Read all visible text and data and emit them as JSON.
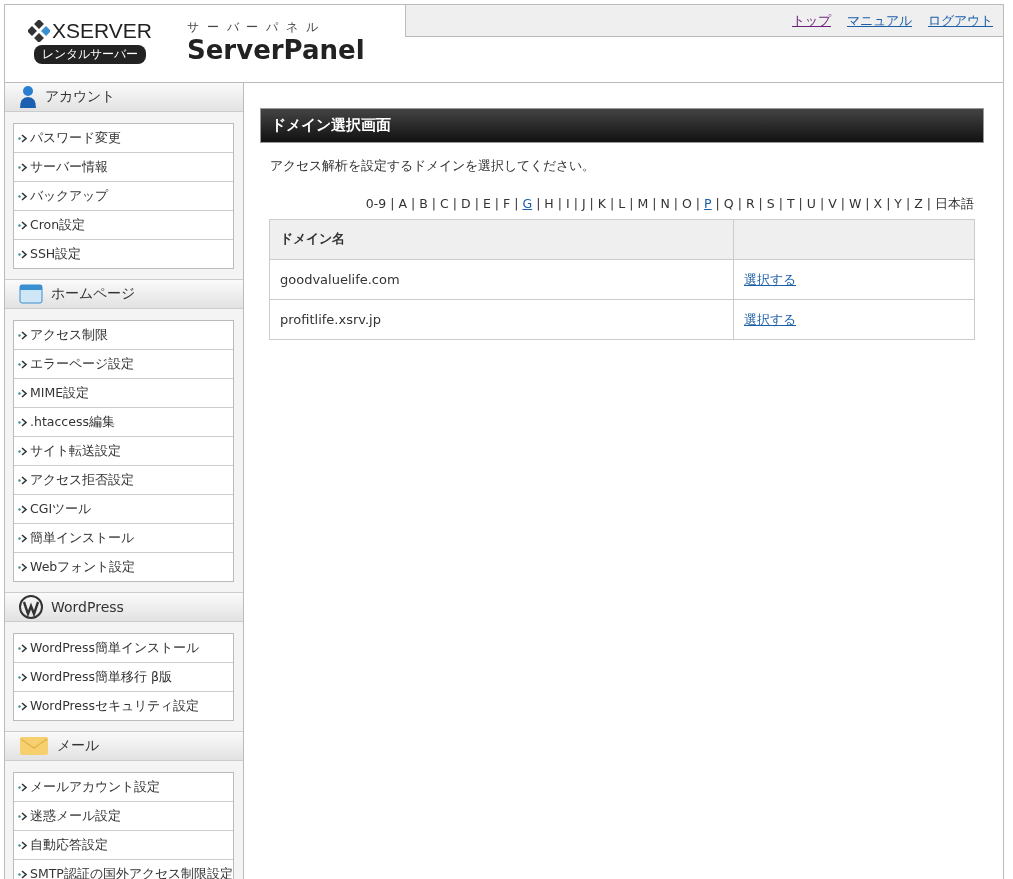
{
  "header": {
    "logo_text": "XSERVER",
    "logo_badge": "レンタルサーバー",
    "panel_kana": "サ ー バ ー パ ネ ル",
    "panel_title": "ServerPanel",
    "links": [
      "トップ",
      "マニュアル",
      "ログアウト"
    ]
  },
  "sidebar": [
    {
      "kind": "account",
      "title": "アカウント",
      "items": [
        "パスワード変更",
        "サーバー情報",
        "バックアップ",
        "Cron設定",
        "SSH設定"
      ]
    },
    {
      "kind": "homepage",
      "title": "ホームページ",
      "items": [
        "アクセス制限",
        "エラーページ設定",
        "MIME設定",
        ".htaccess編集",
        "サイト転送設定",
        "アクセス拒否設定",
        "CGIツール",
        "簡単インストール",
        "Webフォント設定"
      ]
    },
    {
      "kind": "wordpress",
      "title": "WordPress",
      "items": [
        "WordPress簡単インストール",
        "WordPress簡単移行 β版",
        "WordPressセキュリティ設定"
      ]
    },
    {
      "kind": "mail",
      "title": "メール",
      "items": [
        "メールアカウント設定",
        "迷惑メール設定",
        "自動応答設定",
        "SMTP認証の国外アクセス制限設定"
      ]
    }
  ],
  "main": {
    "title": "ドメイン選択画面",
    "instruction": "アクセス解析を設定するドメインを選択してください。",
    "index": [
      {
        "kind": "text",
        "label": "0-9"
      },
      {
        "kind": "sep",
        "label": "|"
      },
      {
        "kind": "text",
        "label": "A"
      },
      {
        "kind": "sep",
        "label": "|"
      },
      {
        "kind": "text",
        "label": "B"
      },
      {
        "kind": "sep",
        "label": "|"
      },
      {
        "kind": "text",
        "label": "C"
      },
      {
        "kind": "sep",
        "label": "|"
      },
      {
        "kind": "text",
        "label": "D"
      },
      {
        "kind": "sep",
        "label": "|"
      },
      {
        "kind": "text",
        "label": "E"
      },
      {
        "kind": "sep",
        "label": "|"
      },
      {
        "kind": "text",
        "label": "F"
      },
      {
        "kind": "sep",
        "label": "|"
      },
      {
        "kind": "link",
        "label": "G"
      },
      {
        "kind": "sep",
        "label": "|"
      },
      {
        "kind": "text",
        "label": "H"
      },
      {
        "kind": "sep",
        "label": "|"
      },
      {
        "kind": "text",
        "label": "I"
      },
      {
        "kind": "sep",
        "label": "|"
      },
      {
        "kind": "text",
        "label": "J"
      },
      {
        "kind": "sep",
        "label": "|"
      },
      {
        "kind": "text",
        "label": "K"
      },
      {
        "kind": "sep",
        "label": "|"
      },
      {
        "kind": "text",
        "label": "L"
      },
      {
        "kind": "sep",
        "label": "|"
      },
      {
        "kind": "text",
        "label": "M"
      },
      {
        "kind": "sep",
        "label": "|"
      },
      {
        "kind": "text",
        "label": "N"
      },
      {
        "kind": "sep",
        "label": "|"
      },
      {
        "kind": "text",
        "label": "O"
      },
      {
        "kind": "sep",
        "label": "|"
      },
      {
        "kind": "link",
        "label": "P"
      },
      {
        "kind": "sep",
        "label": "|"
      },
      {
        "kind": "text",
        "label": "Q"
      },
      {
        "kind": "sep",
        "label": "|"
      },
      {
        "kind": "text",
        "label": "R"
      },
      {
        "kind": "sep",
        "label": "|"
      },
      {
        "kind": "text",
        "label": "S"
      },
      {
        "kind": "sep",
        "label": "|"
      },
      {
        "kind": "text",
        "label": "T"
      },
      {
        "kind": "sep",
        "label": "|"
      },
      {
        "kind": "text",
        "label": "U"
      },
      {
        "kind": "sep",
        "label": "|"
      },
      {
        "kind": "text",
        "label": "V"
      },
      {
        "kind": "sep",
        "label": "|"
      },
      {
        "kind": "text",
        "label": "W"
      },
      {
        "kind": "sep",
        "label": "|"
      },
      {
        "kind": "text",
        "label": "X"
      },
      {
        "kind": "sep",
        "label": "|"
      },
      {
        "kind": "text",
        "label": "Y"
      },
      {
        "kind": "sep",
        "label": "|"
      },
      {
        "kind": "text",
        "label": "Z"
      },
      {
        "kind": "sep",
        "label": "|"
      },
      {
        "kind": "text",
        "label": "日本語"
      }
    ],
    "table": {
      "columns": [
        "ドメイン名"
      ],
      "rows": [
        {
          "domain": "goodvaluelife.com",
          "action": "選択する"
        },
        {
          "domain": "profitlife.xsrv.jp",
          "action": "選択する"
        }
      ]
    }
  }
}
